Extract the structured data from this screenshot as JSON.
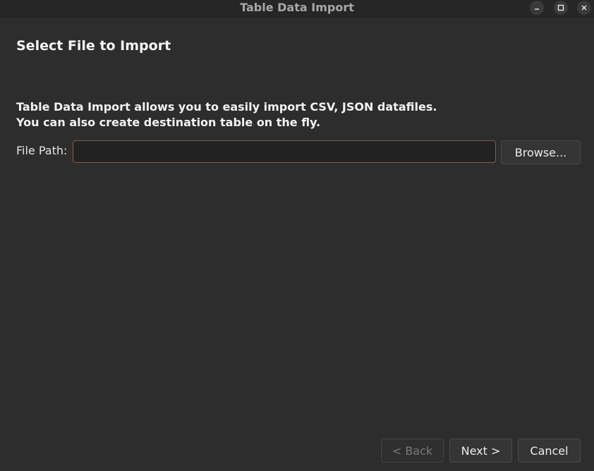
{
  "window": {
    "title": "Table Data Import",
    "controls": {
      "minimize_icon": "minimize-icon",
      "maximize_icon": "maximize-icon",
      "close_icon": "close-icon"
    }
  },
  "page": {
    "title": "Select File to Import",
    "description_line1": "Table Data Import allows you to easily import CSV, JSON datafiles.",
    "description_line2": "You can also create destination table on the fly."
  },
  "file": {
    "label": "File Path:",
    "value": "",
    "placeholder": "",
    "browse_label": "Browse..."
  },
  "footer": {
    "back_label": "< Back",
    "next_label": "Next >",
    "cancel_label": "Cancel"
  },
  "colors": {
    "background": "#2d2d2d",
    "input_focus_border": "#8a5a43",
    "disabled_text": "#7a7a7a"
  }
}
